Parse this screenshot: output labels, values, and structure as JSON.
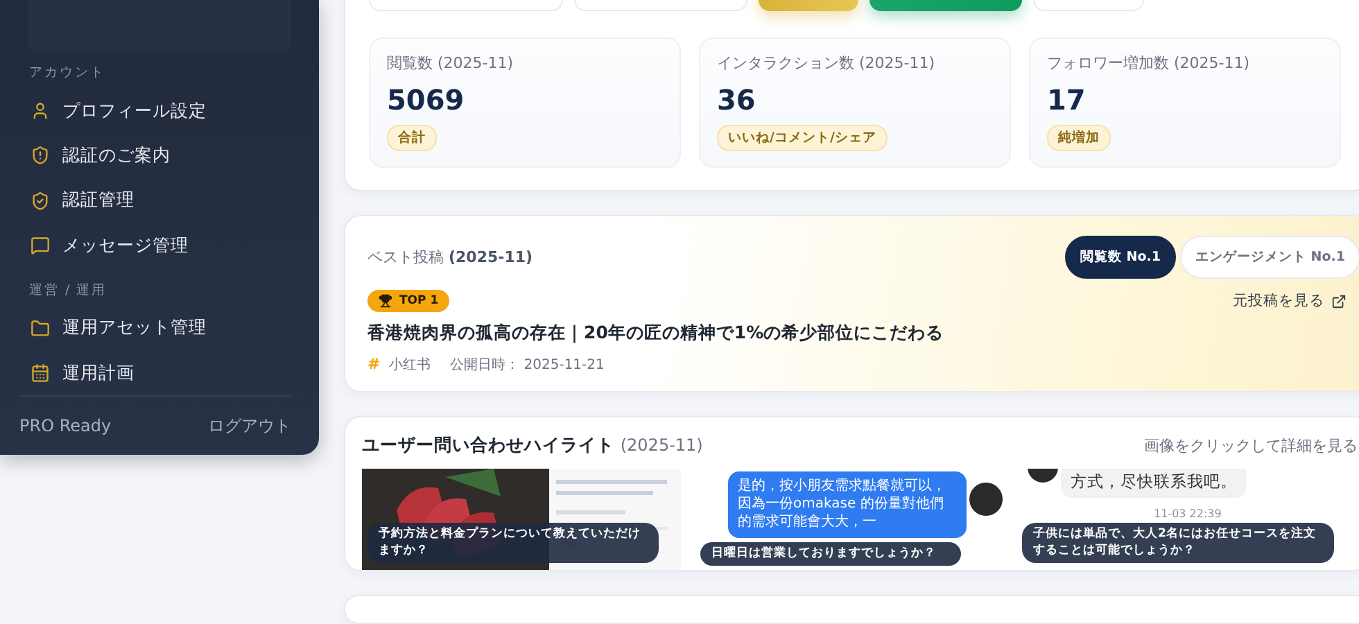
{
  "sidebar": {
    "sections": [
      {
        "label": "アカウント",
        "items": [
          {
            "label": "プロフィール設定"
          },
          {
            "label": "認証のご案内"
          },
          {
            "label": "認証管理"
          },
          {
            "label": "メッセージ管理"
          }
        ]
      },
      {
        "label": "運営 / 運用",
        "items": [
          {
            "label": "運用アセット管理"
          },
          {
            "label": "運用計画"
          }
        ]
      }
    ],
    "plan": "PRO Ready",
    "logout": "ログアウト"
  },
  "top_buttons": [
    {
      "kind": "plain"
    },
    {
      "kind": "plain"
    },
    {
      "kind": "gold"
    },
    {
      "kind": "green"
    },
    {
      "kind": "plain"
    }
  ],
  "stats": [
    {
      "label": "閲覧数",
      "period": "(2025-11)",
      "value": "5069",
      "tag": "合計"
    },
    {
      "label": "インタラクション数",
      "period": "(2025-11)",
      "value": "36",
      "tag": "いいね/コメント/シェア"
    },
    {
      "label": "フォロワー増加数",
      "period": "(2025-11)",
      "value": "17",
      "tag": "純増加"
    }
  ],
  "best_post": {
    "title": "ベスト投稿",
    "period": "(2025-11)",
    "tabs": [
      {
        "label": "閲覧数 No.1",
        "selected": true
      },
      {
        "label": "エンゲージメント No.1",
        "selected": false
      }
    ],
    "badge": "TOP 1",
    "link": "元投稿を見る",
    "headline": "香港焼肉界の孤高の存在｜20年の匠の精神で1%の希少部位にこだわる",
    "platform_mark": "#",
    "platform": "小红书",
    "published": "公開日時： 2025-11-21"
  },
  "inquiries": {
    "title": "ユーザー問い合わせハイライト",
    "period": "(2025-11)",
    "hint": "画像をクリックして詳細を見る",
    "items": [
      {
        "kind": "picture",
        "caption": "予約方法と料金プランについて教えていただけますか？"
      },
      {
        "kind": "reply",
        "bubble": "是的，按小朋友需求點餐就可以，因為一份omakase 的份量對他們的需求可能會大大，一",
        "caption": "日曜日は営業しておりますでしょうか？"
      },
      {
        "kind": "chat",
        "bubble": "方式，尽快联系我吧。",
        "time": "11-03 22:39",
        "caption": "子供には単品で、大人2名にはお任せコースを注文することは可能でしょうか？"
      }
    ]
  }
}
